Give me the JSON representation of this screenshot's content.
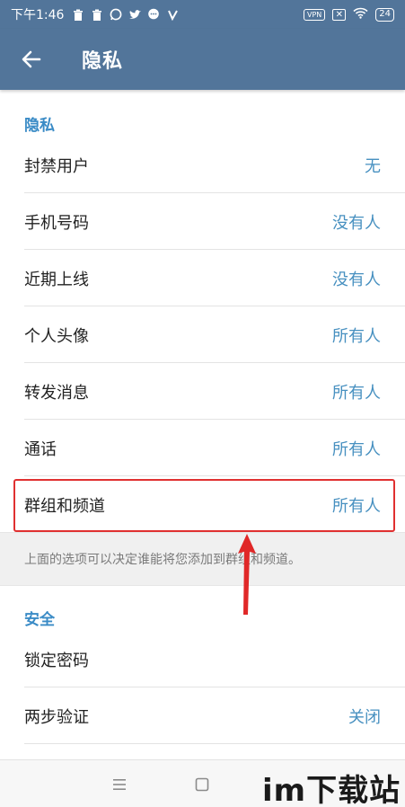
{
  "status_bar": {
    "time": "下午1:46",
    "vpn": "VPN",
    "battery": "24",
    "icons": [
      "trash-icon",
      "trash-icon",
      "whatsapp-icon",
      "twitter-icon",
      "message-icon",
      "v-icon"
    ]
  },
  "app_bar": {
    "title": "隐私"
  },
  "privacy_section": {
    "header": "隐私",
    "rows": [
      {
        "label": "封禁用户",
        "value": "无"
      },
      {
        "label": "手机号码",
        "value": "没有人"
      },
      {
        "label": "近期上线",
        "value": "没有人"
      },
      {
        "label": "个人头像",
        "value": "所有人"
      },
      {
        "label": "转发消息",
        "value": "所有人"
      },
      {
        "label": "通话",
        "value": "所有人"
      },
      {
        "label": "群组和频道",
        "value": "所有人"
      }
    ],
    "note": "上面的选项可以决定谁能将您添加到群组和频道。"
  },
  "security_section": {
    "header": "安全",
    "rows": [
      {
        "label": "锁定密码",
        "value": ""
      },
      {
        "label": "两步验证",
        "value": "关闭"
      }
    ]
  },
  "watermark": "im下载站",
  "colors": {
    "app_bar": "#52759a",
    "accent_text": "#3a8bc6",
    "value_text": "#4790c0",
    "highlight": "#e03030"
  }
}
